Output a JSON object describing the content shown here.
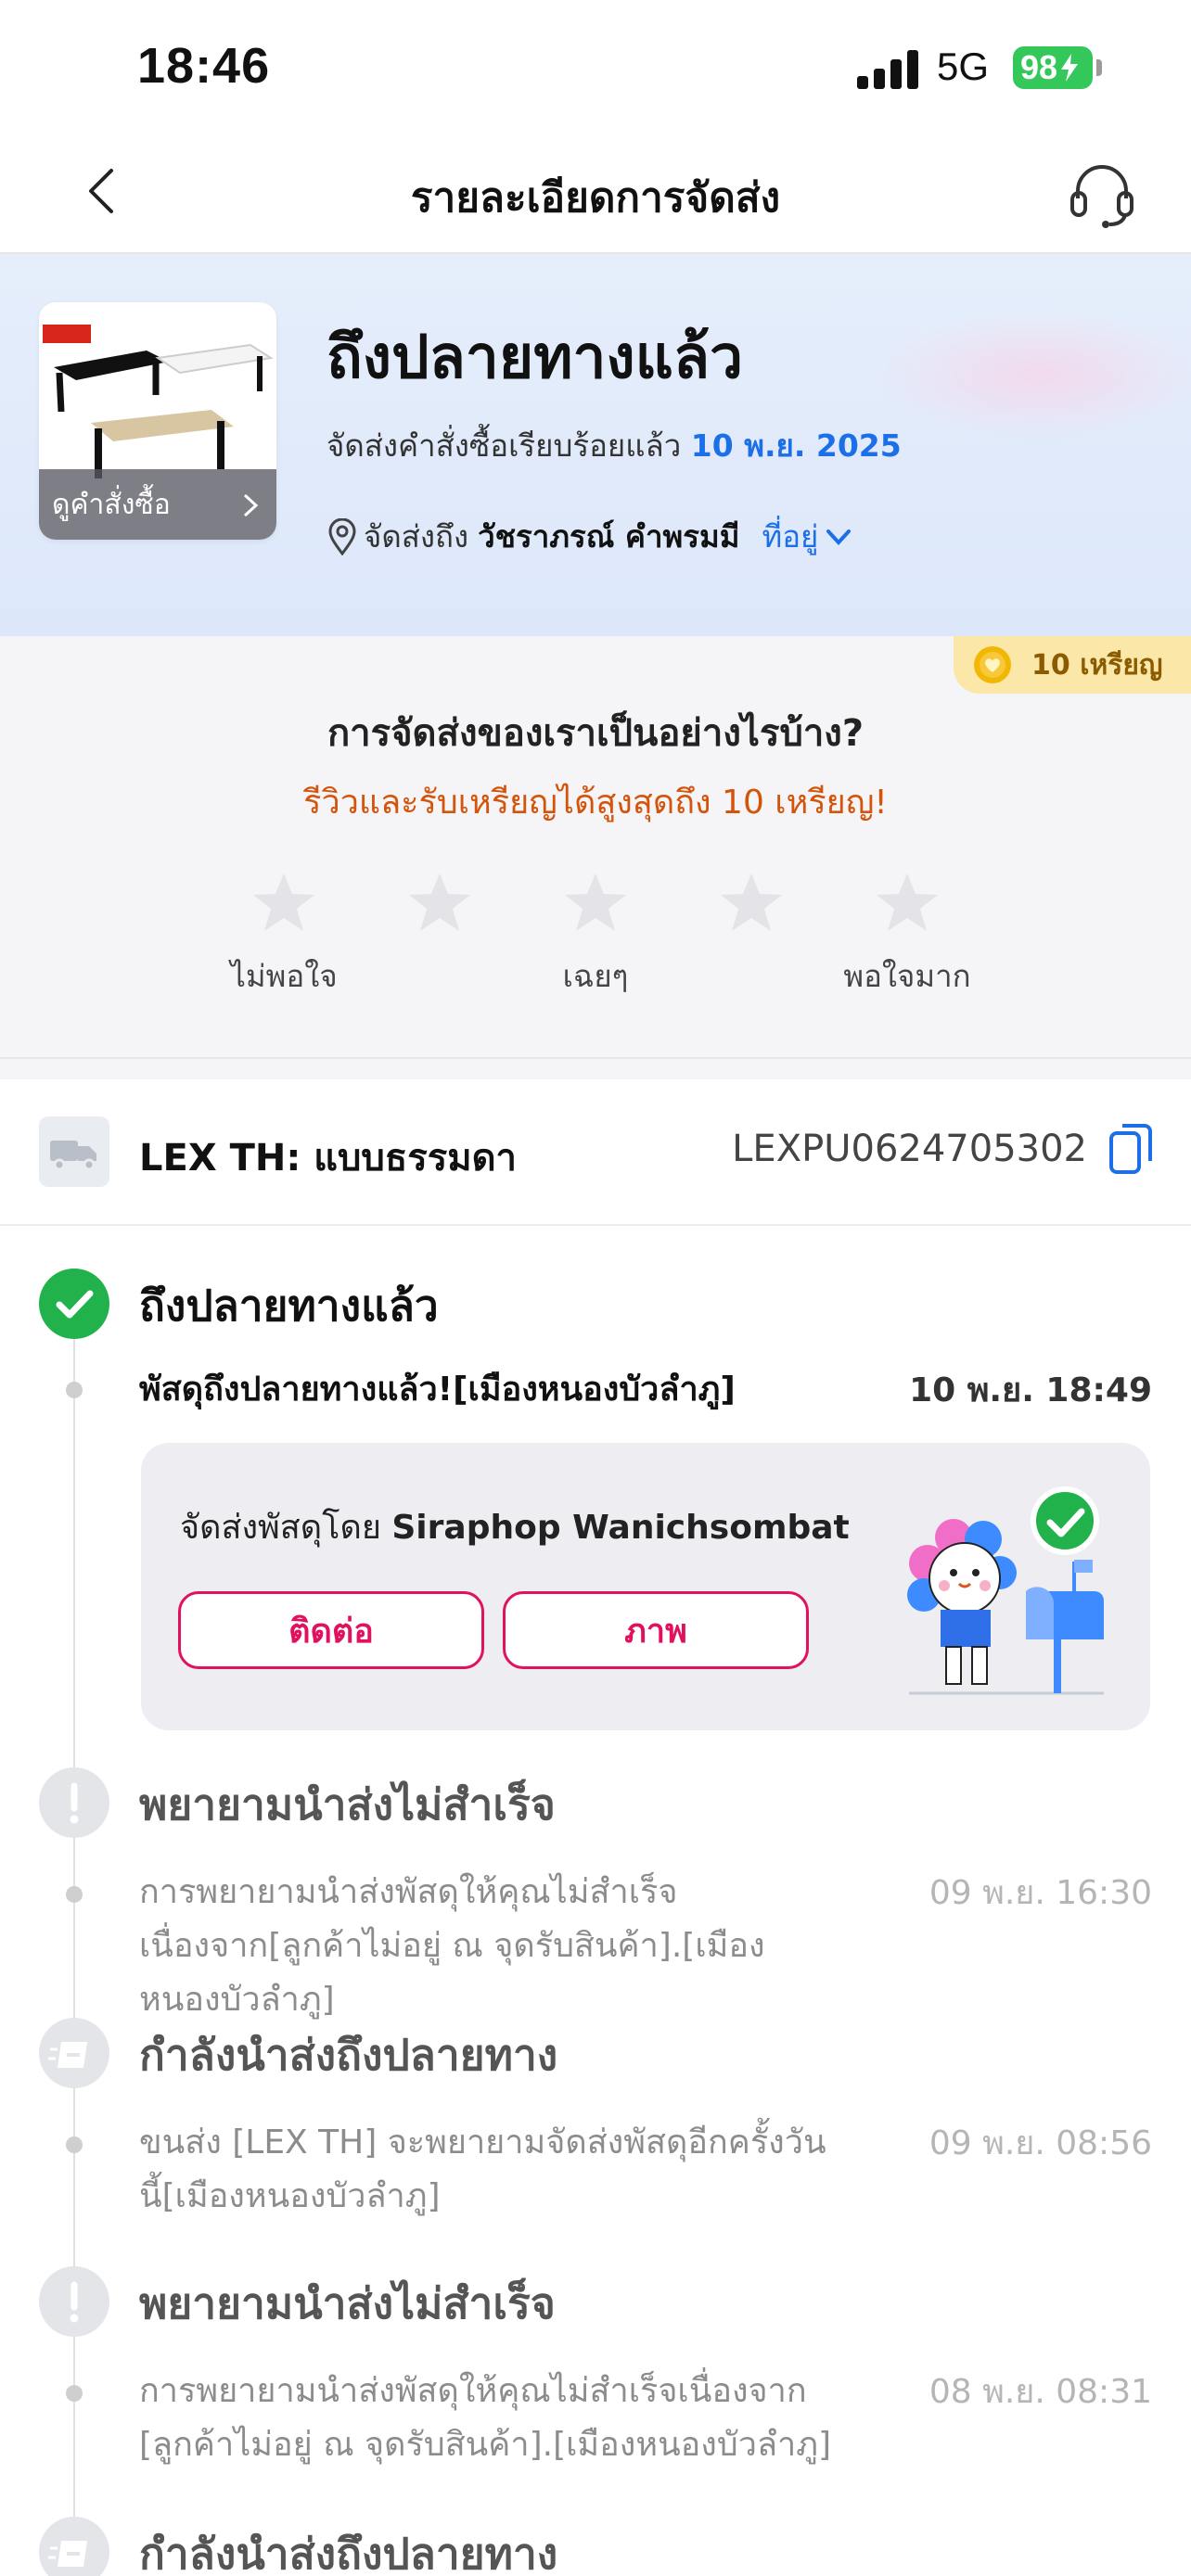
{
  "status_bar": {
    "time": "18:46",
    "network": "5G",
    "battery": "98"
  },
  "header": {
    "title": "รายละเอียดการจัดส่ง"
  },
  "hero": {
    "status_title": "ถึงปลายทางแล้ว",
    "delivered_text": "จัดส่งคำสั่งซื้อเรียบร้อยแล้ว",
    "delivered_date": "10 พ.ย. 2025",
    "ship_to_label": "จัดส่งถึง",
    "recipient_name": "วัชราภรณ์ คำพรมมี",
    "address_link": "ที่อยู่",
    "view_order_label": "ดูคำสั่งซื้อ"
  },
  "review": {
    "coin_badge": "10 เหรียญ",
    "question": "การจัดส่งของเราเป็นอย่างไรบ้าง?",
    "promo": "รีวิวและรับเหรียญได้สูงสุดถึง 10 เหรียญ!",
    "labels": [
      "ไม่พอใจ",
      "เฉยๆ",
      "พอใจมาก"
    ]
  },
  "carrier": {
    "name": "LEX TH: แบบธรรมดา",
    "tracking_number": "LEXPU0624705302"
  },
  "timeline": [
    {
      "status": "ถึงปลายทางแล้ว",
      "description": "พัสดุถึงปลายทางแล้ว![เมืองหนองบัวลำภู]",
      "time": "10 พ.ย. 18:49",
      "courier_prefix": "จัดส่งพัสดุโดย",
      "courier_name": "Siraphop Wanichsombat",
      "contact_label": "ติดต่อ",
      "photo_label": "ภาพ"
    },
    {
      "status": "พยายามนำส่งไม่สำเร็จ",
      "description": "การพยายามนำส่งพัสดุให้คุณไม่สำเร็จเนื่องจาก[ลูกค้าไม่อยู่ ณ จุดรับสินค้า].[เมืองหนองบัวลำภู]",
      "time": "09 พ.ย. 16:30"
    },
    {
      "status": "กำลังนำส่งถึงปลายทาง",
      "description": "ขนส่ง [LEX TH] จะพยายามจัดส่งพัสดุอีกครั้งวันนี้[เมืองหนองบัวลำภู]",
      "time": "09 พ.ย. 08:56"
    },
    {
      "status": "พยายามนำส่งไม่สำเร็จ",
      "description": "การพยายามนำส่งพัสดุให้คุณไม่สำเร็จเนื่องจาก [ลูกค้าไม่อยู่ ณ จุดรับสินค้า].[เมืองหนองบัวลำภู]",
      "time": "08 พ.ย. 08:31"
    },
    {
      "status": "กำลังนำส่งถึงปลายทาง"
    }
  ],
  "colors": {
    "accent_blue": "#1d6fe8",
    "success_green": "#22b24c",
    "action_pink": "#e0115f",
    "promo_orange": "#d4540b"
  }
}
